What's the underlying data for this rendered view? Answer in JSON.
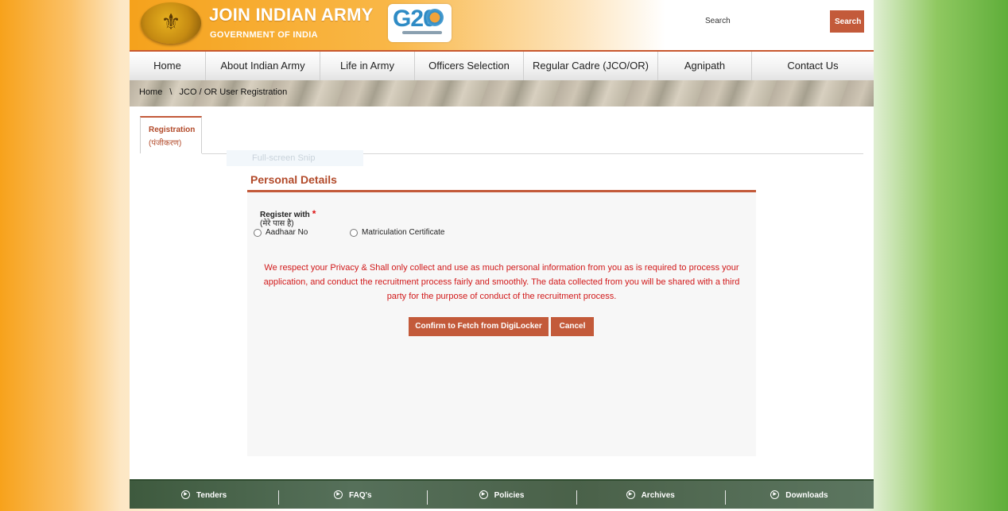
{
  "header": {
    "brand_title": "JOIN INDIAN ARMY",
    "brand_subtitle": "GOVERNMENT OF INDIA",
    "g20_text": "G20",
    "search_label": "Search",
    "search_button": "Search"
  },
  "nav": {
    "items": [
      {
        "label": "Home"
      },
      {
        "label": "About Indian Army"
      },
      {
        "label": "Life in Army"
      },
      {
        "label": "Officers Selection"
      },
      {
        "label": "Regular Cadre (JCO/OR)"
      },
      {
        "label": "Agnipath"
      },
      {
        "label": "Contact Us"
      }
    ]
  },
  "breadcrumb": {
    "home": "Home",
    "sep": "\\",
    "current": "JCO / OR User Registration"
  },
  "tab": {
    "label": "Registration",
    "label_hi": "(पंजीकरण)"
  },
  "overlay_text": "Full-screen Snip",
  "panel": {
    "title": "Personal Details",
    "register_label": "Register with",
    "required_mark": "*",
    "register_hi": "(मेरे पास है)",
    "options": [
      {
        "label": "Aadhaar No"
      },
      {
        "label": "Matriculation Certificate"
      }
    ],
    "privacy_text": "We respect your Privacy & Shall only collect and use as much personal information from you as is required to process your application, and conduct the recruitment process fairly and smoothly. The data collected from you will be shared with a third party for the purpose of conduct of the recruitment process.",
    "confirm_button": "Confirm to Fetch from DigiLocker",
    "cancel_button": "Cancel"
  },
  "footer": {
    "items": [
      {
        "label": "Tenders"
      },
      {
        "label": "FAQ's"
      },
      {
        "label": "Policies"
      },
      {
        "label": "Archives"
      },
      {
        "label": "Downloads"
      }
    ]
  },
  "colors": {
    "accent": "#c35a3a",
    "privacy_text": "#d1191a",
    "footer_bg": "#4a6149"
  }
}
